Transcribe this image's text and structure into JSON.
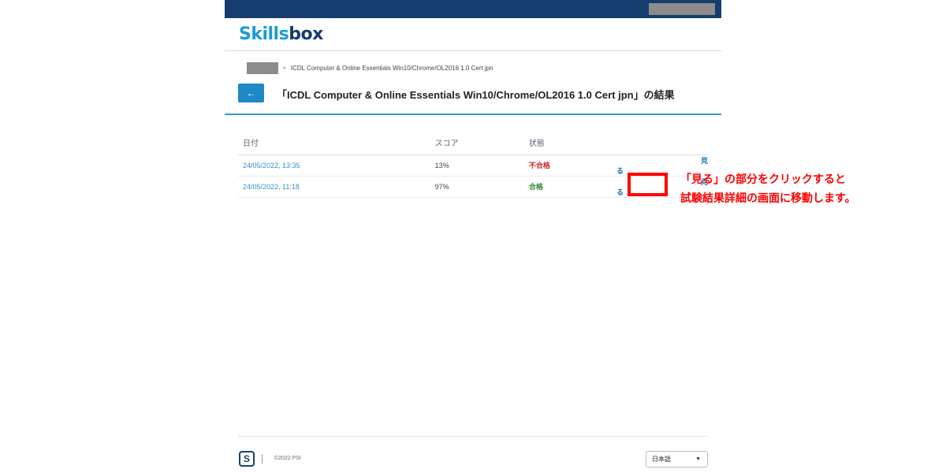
{
  "header": {
    "logo_part1": "Skills",
    "logo_part2": "box"
  },
  "breadcrumb": {
    "separator": "»",
    "current": "ICDL Computer & Online Essentials Win10/Chrome/OL2016 1.0 Cert jpn"
  },
  "page": {
    "back_icon": "←",
    "title": "「ICDL Computer & Online Essentials Win10/Chrome/OL2016 1.0 Cert jpn」の結果"
  },
  "table": {
    "headers": {
      "date": "日付",
      "score": "スコア",
      "status": "状態"
    },
    "rows": [
      {
        "date": "24/05/2022, 13:35",
        "score": "13%",
        "status": "不合格",
        "status_type": "fail",
        "view": "見る"
      },
      {
        "date": "24/05/2022, 11:18",
        "score": "97%",
        "status": "合格",
        "status_type": "pass",
        "view": "見る"
      }
    ]
  },
  "annotation": {
    "line1": "「見る」の部分をクリックすると",
    "line2": "試験結果詳細の画面に移動します。"
  },
  "footer": {
    "logo_letter": "S",
    "copyright": "©2022 PSI",
    "language": "日本語",
    "caret_icon": "▼"
  },
  "colors": {
    "topbar": "#143d6e",
    "accent": "#1f88c9",
    "fail": "#c62828",
    "pass": "#2e8b2e",
    "highlight": "#ff0000"
  }
}
